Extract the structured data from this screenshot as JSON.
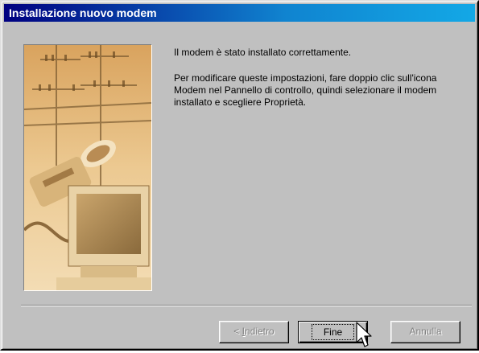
{
  "window": {
    "title": "Installazione nuovo modem"
  },
  "body": {
    "paragraph1": "Il modem è stato installato correttamente.",
    "paragraph2": "Per modificare queste impostazioni, fare doppio clic sull'icona Modem nel Pannello di controllo, quindi selezionare il modem installato e scegliere Proprietà."
  },
  "buttons": {
    "back_prefix": "< ",
    "back_mnemonic": "I",
    "back_rest": "ndietro",
    "finish": "Fine",
    "cancel": "Annulla"
  },
  "colors": {
    "titlebar_start": "#000080",
    "titlebar_end": "#13a8e6",
    "dialog_face": "#c0c0c0"
  },
  "icons": {
    "cursor": "arrow-cursor-icon"
  }
}
